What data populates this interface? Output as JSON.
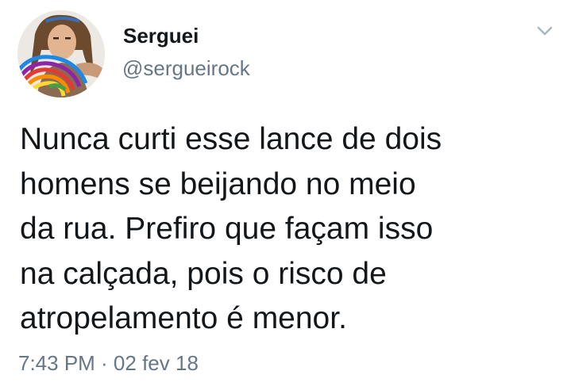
{
  "tweet": {
    "author": {
      "display_name": "Serguei",
      "handle": "@sergueirock",
      "avatar_icon": "profile-photo"
    },
    "menu_icon": "chevron-down-icon",
    "text": "Nunca curti esse lance de dois\nhomens se beijando no meio\nda rua. Prefiro que façam isso\nna calçada, pois o risco de\natropelamento é menor.",
    "timestamp": "7:43 PM · 02 fev 18"
  },
  "colors": {
    "text_primary": "#14171a",
    "text_secondary": "#657786",
    "chevron": "#aab8c2",
    "background": "#ffffff"
  }
}
